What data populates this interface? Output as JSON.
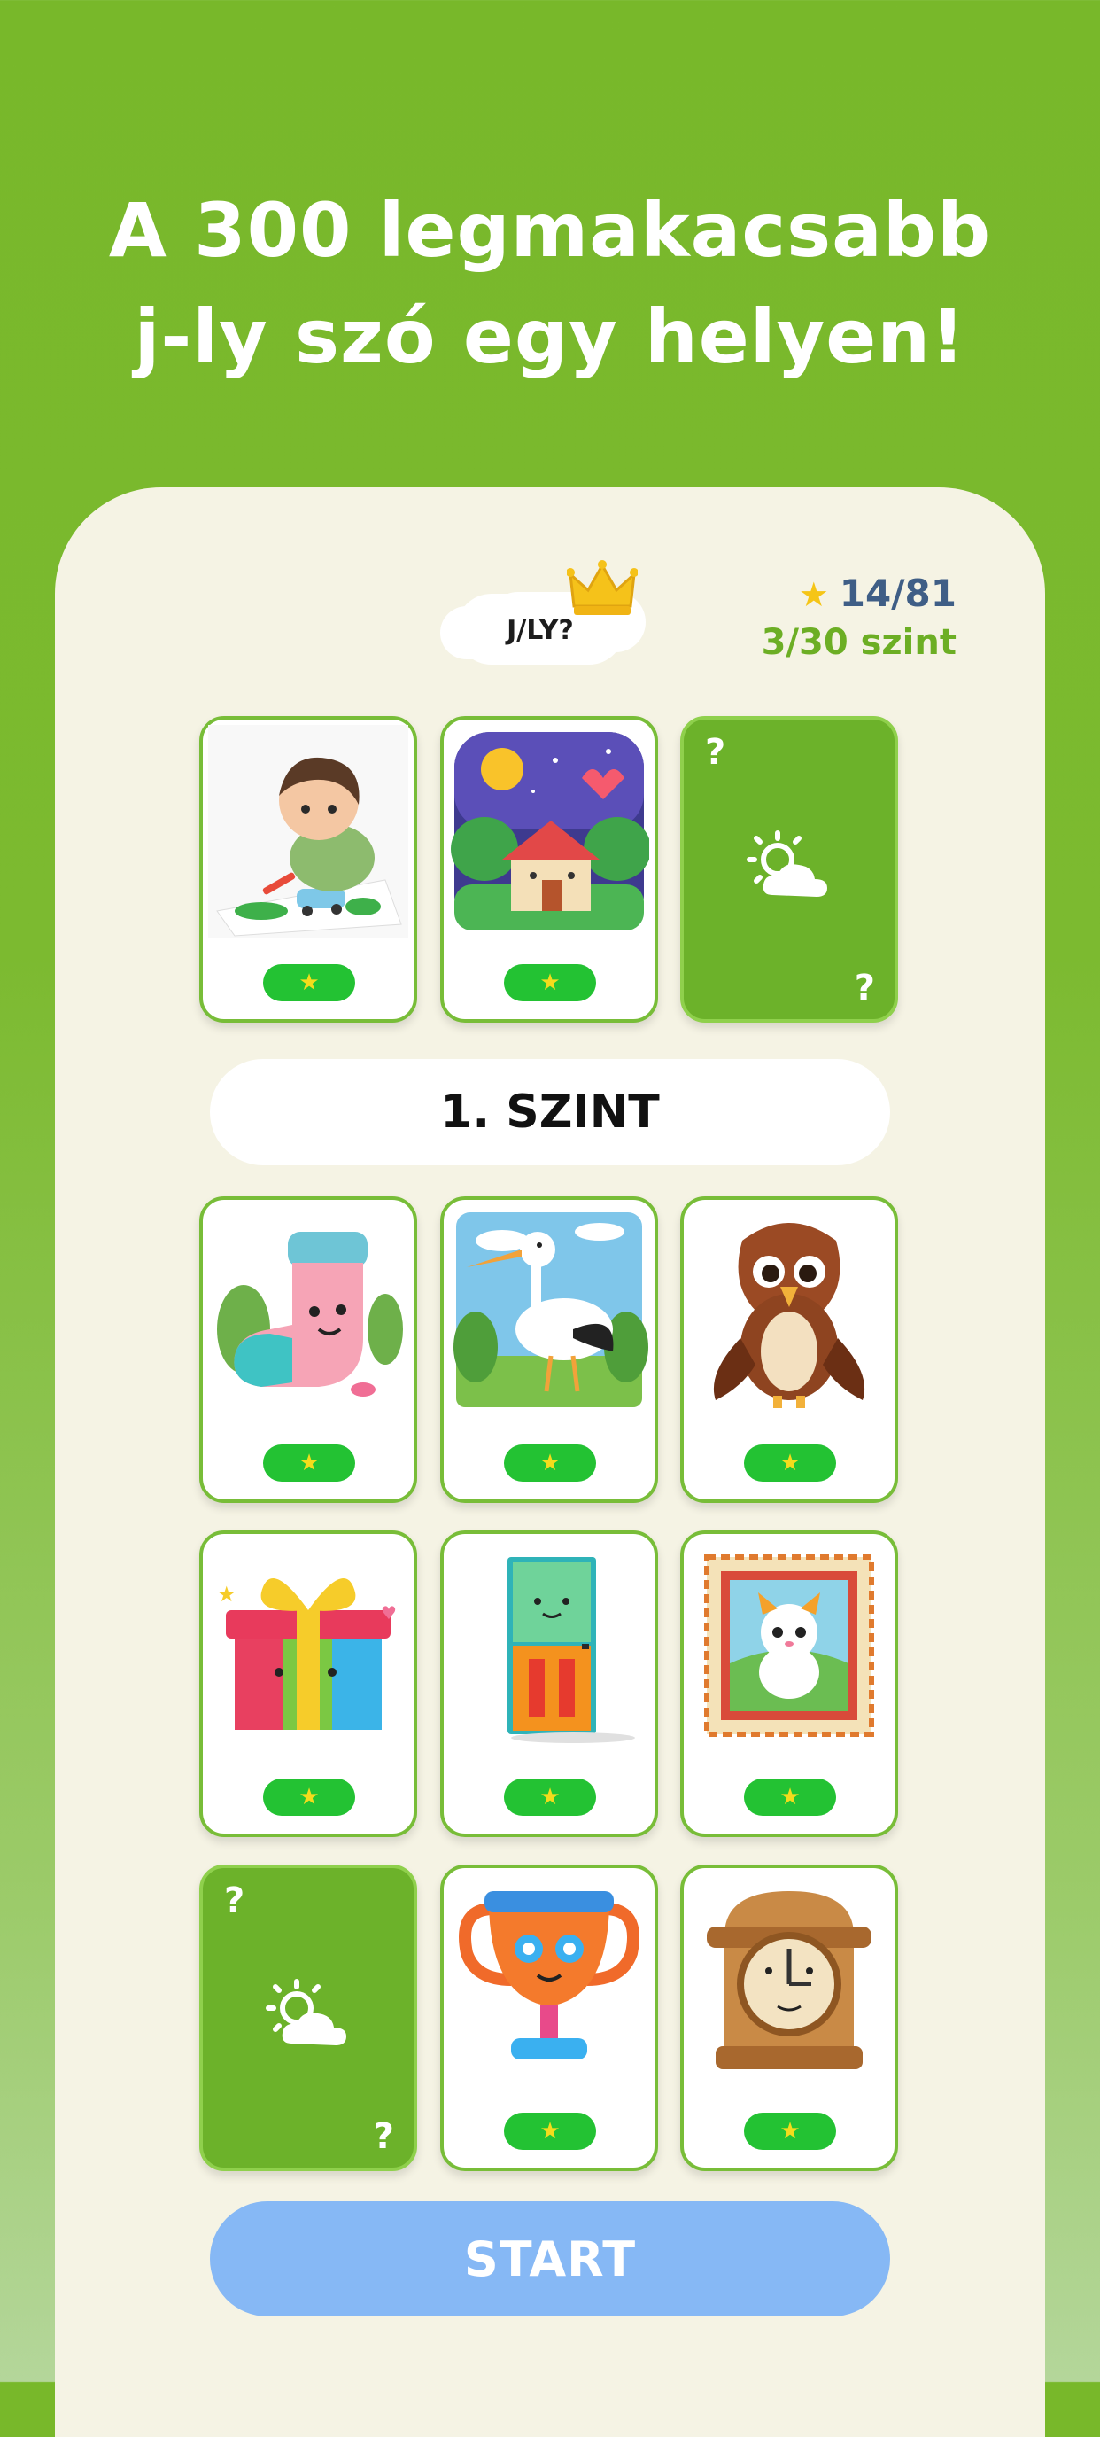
{
  "headline": {
    "line1": "A 300 legmakacsabb",
    "line2": "j-ly szó egy helyen!"
  },
  "logo": {
    "text": "J/LY?",
    "crown_icon": "crown-icon"
  },
  "stats": {
    "star_icon": "★",
    "stars": "14/81",
    "level": "3/30 szint"
  },
  "level_label": "1. SZINT",
  "start_label": "START",
  "cards": [
    {
      "icon": "boy-drawing-icon",
      "star": "★"
    },
    {
      "icon": "house-night-sky-icon",
      "star": "★"
    },
    {
      "icon": "weather-icon",
      "hidden": true,
      "q": "?"
    },
    {
      "icon": "sock-icon",
      "star": "★"
    },
    {
      "icon": "stork-icon",
      "star": "★"
    },
    {
      "icon": "hawk-icon",
      "star": "★"
    },
    {
      "icon": "gift-box-icon",
      "star": "★"
    },
    {
      "icon": "door-icon",
      "star": "★"
    },
    {
      "icon": "stamp-icon",
      "star": "★"
    },
    {
      "icon": "weather-icon",
      "hidden": true,
      "q": "?"
    },
    {
      "icon": "trophy-icon",
      "star": "★"
    },
    {
      "icon": "clock-icon",
      "star": "★"
    }
  ],
  "colors": {
    "background_green": "#78b82a",
    "panel": "#f5f3e4",
    "card_border": "#78bd38",
    "pill_green": "#23c233",
    "star_yellow": "#f3dc1c",
    "start_blue": "#86b8f5",
    "stars_text": "#3f5e86",
    "level_text": "#6cae24"
  }
}
